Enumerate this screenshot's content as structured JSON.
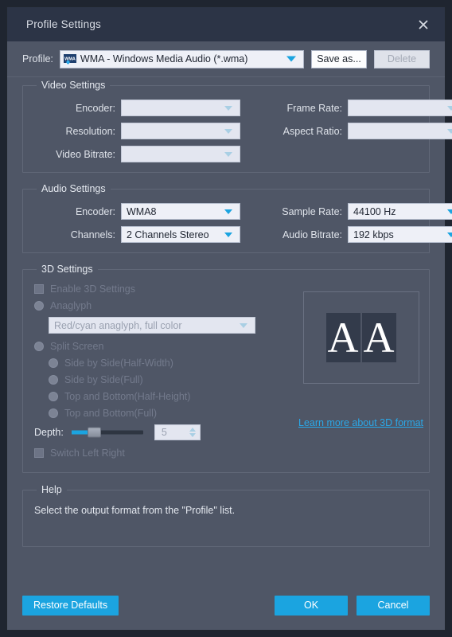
{
  "window": {
    "title": "Profile Settings",
    "close_icon": "close-icon"
  },
  "profile_bar": {
    "label": "Profile:",
    "icon": "wma-format-icon",
    "selected": "WMA - Windows Media Audio (*.wma)",
    "dropdown_icon": "chevron-down-icon",
    "save_as_label": "Save as...",
    "delete_label": "Delete"
  },
  "video_settings": {
    "legend": "Video Settings",
    "encoder_label": "Encoder:",
    "encoder_value": "",
    "resolution_label": "Resolution:",
    "resolution_value": "",
    "video_bitrate_label": "Video Bitrate:",
    "video_bitrate_value": "",
    "frame_rate_label": "Frame Rate:",
    "frame_rate_value": "",
    "aspect_ratio_label": "Aspect Ratio:",
    "aspect_ratio_value": ""
  },
  "audio_settings": {
    "legend": "Audio Settings",
    "encoder_label": "Encoder:",
    "encoder_value": "WMA8",
    "channels_label": "Channels:",
    "channels_value": "2 Channels Stereo",
    "sample_rate_label": "Sample Rate:",
    "sample_rate_value": "44100 Hz",
    "audio_bitrate_label": "Audio Bitrate:",
    "audio_bitrate_value": "192 kbps"
  },
  "three_d_settings": {
    "legend": "3D Settings",
    "enable_label": "Enable 3D Settings",
    "anaglyph_label": "Anaglyph",
    "anaglyph_value": "Red/cyan anaglyph, full color",
    "split_screen_label": "Split Screen",
    "split_options": [
      "Side by Side(Half-Width)",
      "Side by Side(Full)",
      "Top and Bottom(Half-Height)",
      "Top and Bottom(Full)"
    ],
    "depth_label": "Depth:",
    "depth_value": "5",
    "switch_label": "Switch Left Right",
    "preview_glyph_left": "A",
    "preview_glyph_right": "A",
    "learn_more_label": "Learn more about 3D format"
  },
  "help": {
    "legend": "Help",
    "text": "Select the output format from the \"Profile\" list."
  },
  "footer": {
    "restore_label": "Restore Defaults",
    "ok_label": "OK",
    "cancel_label": "Cancel"
  },
  "colors": {
    "accent": "#1ba4e0",
    "window_bg": "#4f5666",
    "titlebar_bg": "#2c3446",
    "field_bg": "#eef0f7",
    "disabled_text": "#737a8c"
  }
}
